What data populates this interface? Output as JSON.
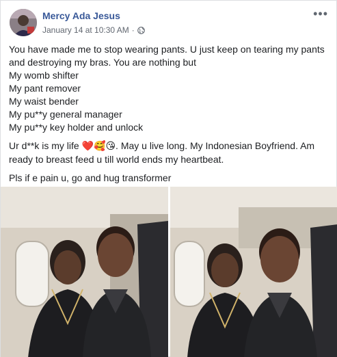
{
  "post": {
    "author": "Mercy Ada Jesus",
    "date": "January 14 at 10:30 AM",
    "separator": "·",
    "more_icon": "more-options-icon",
    "privacy_icon": "globe-icon",
    "lines": [
      "You have made me to stop wearing pants. U just keep on tearing my pants and destroying my bras. You are nothing but",
      "My womb shifter",
      "My pant remover",
      "My waist bender",
      "My pu**y general manager",
      "My pu**y key holder and unlock"
    ],
    "paragraph2": {
      "before_emoji": "Ur d**k is my life ",
      "emojis": "❤️🥰😘",
      "after_emoji": ". May u live long. My Indonesian Boyfriend. Am ready to breast feed u till world ends my heartbeat."
    },
    "paragraph3": "Pls if e pain u, go and hug transformer"
  },
  "photos": [
    {
      "description_icon": "couple-photo-1"
    },
    {
      "description_icon": "couple-photo-2"
    }
  ],
  "colors": {
    "author_link": "#385898",
    "meta_gray": "#616770",
    "text": "#1c1e21"
  }
}
